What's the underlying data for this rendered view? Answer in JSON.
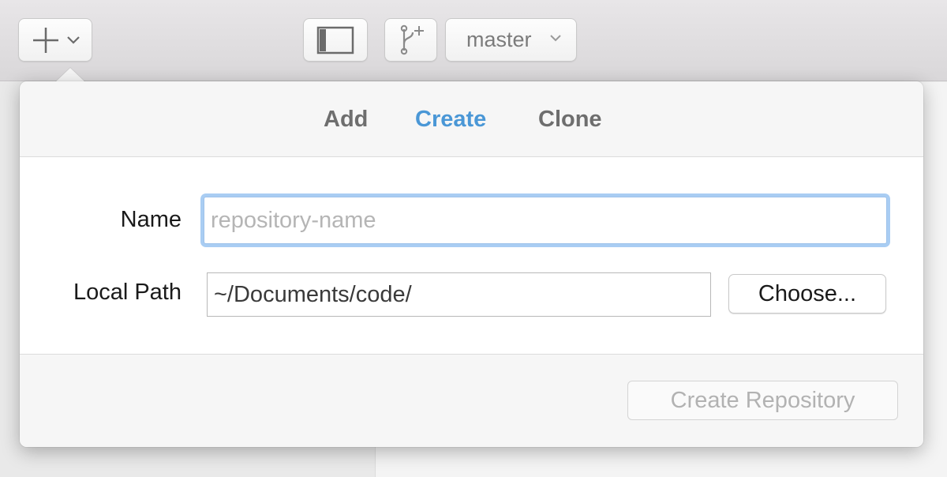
{
  "toolbar": {
    "branch_name": "master"
  },
  "popover": {
    "tabs": [
      {
        "label": "Add",
        "active": false
      },
      {
        "label": "Create",
        "active": true
      },
      {
        "label": "Clone",
        "active": false
      }
    ],
    "form": {
      "name_label": "Name",
      "name_placeholder": "repository-name",
      "name_value": "",
      "path_label": "Local Path",
      "path_value": "~/Documents/code/",
      "choose_label": "Choose..."
    },
    "create_button_label": "Create Repository"
  },
  "colors": {
    "accent": "#4a97d6",
    "focus_ring": "#a9cdf3"
  },
  "icons": [
    "plus-icon",
    "chevron-down-icon",
    "sidebar-toggle-icon",
    "new-branch-icon"
  ]
}
